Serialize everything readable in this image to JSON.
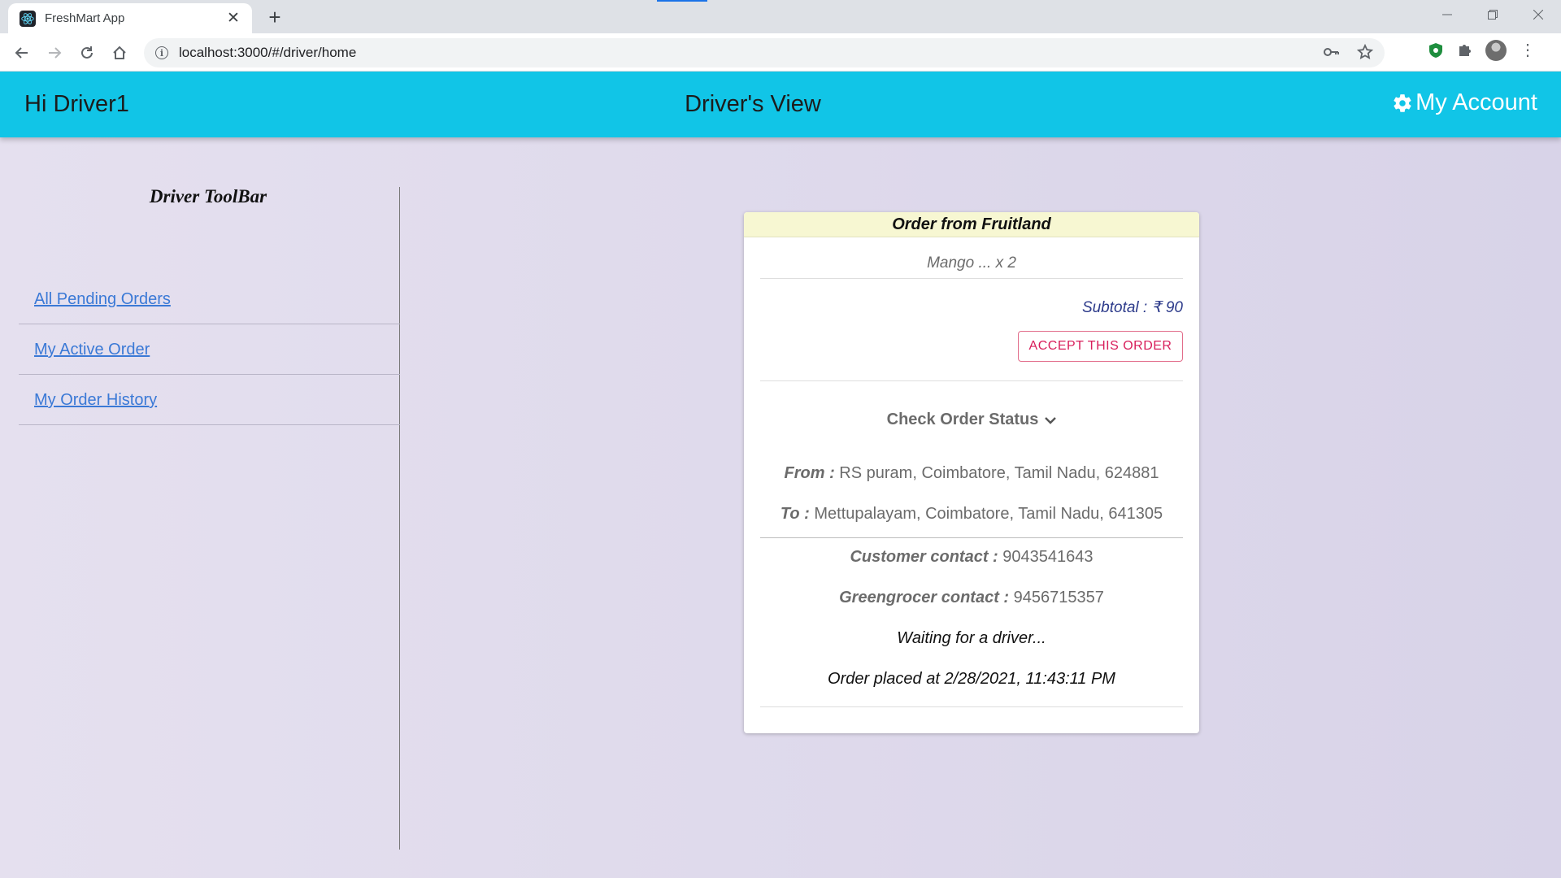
{
  "browser": {
    "tab_title": "FreshMart App",
    "url": "localhost:3000/#/driver/home"
  },
  "appbar": {
    "greeting": "Hi Driver1",
    "title": "Driver's View",
    "account_label": "My Account"
  },
  "sidebar": {
    "title": "Driver ToolBar",
    "items": [
      {
        "label": "All Pending Orders"
      },
      {
        "label": "My Active Order"
      },
      {
        "label": "My Order History"
      }
    ]
  },
  "order": {
    "header": "Order from Fruitland",
    "item": "Mango ... x 2",
    "subtotal": "Subtotal : ₹ 90",
    "accept_label": "ACCEPT THIS ORDER",
    "status_toggle_label": "Check Order Status",
    "from_label": "From :",
    "from_value": "RS puram, Coimbatore, Tamil Nadu, 624881",
    "to_label": "To :",
    "to_value": "Mettupalayam, Coimbatore, Tamil Nadu, 641305",
    "customer_label": "Customer contact :",
    "customer_value": "9043541643",
    "grocer_label": "Greengrocer contact :",
    "grocer_value": "9456715357",
    "waiting_text": "Waiting for a driver...",
    "placed_text": "Order placed at 2/28/2021, 11:43:11 PM"
  },
  "colors": {
    "appbar": "#11c5e7",
    "link": "#3a79d6",
    "accept": "#d81e5b",
    "card_header": "#f7f7d2"
  }
}
